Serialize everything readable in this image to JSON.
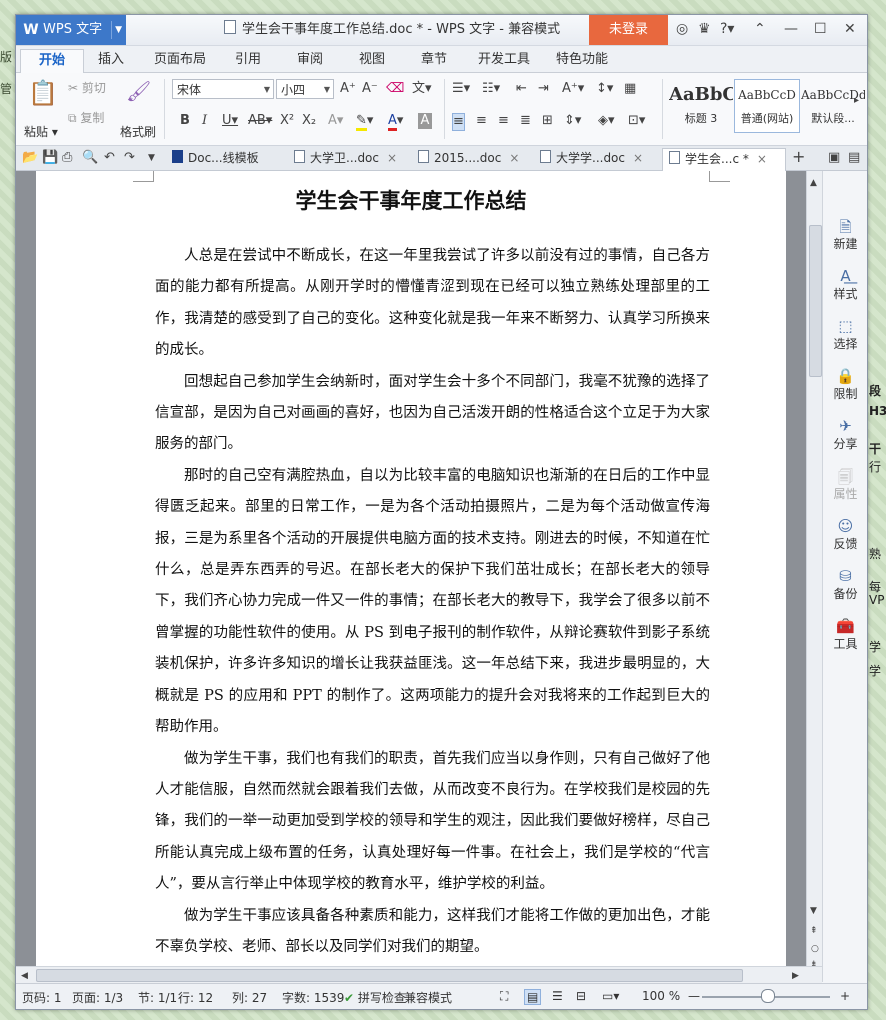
{
  "window": {
    "app_button": "WPS 文字",
    "title": "学生会干事年度工作总结.doc * - WPS 文字 - 兼容模式",
    "login": "未登录"
  },
  "background": {
    "left_fragments": [
      "版",
      "管"
    ],
    "right_fragments": [
      "段",
      "H3",
      "干",
      "行",
      "熟",
      "每",
      "VP",
      "学",
      "学"
    ]
  },
  "ribbon_tabs": [
    "开始",
    "插入",
    "页面布局",
    "引用",
    "审阅",
    "视图",
    "章节",
    "开发工具",
    "特色功能"
  ],
  "ribbon": {
    "paste": "粘贴",
    "cut": "剪切",
    "copy": "复制",
    "format_painter": "格式刷",
    "font_name": "宋体",
    "font_size": "小四",
    "styles": [
      {
        "sample": "AaBbC",
        "label": "标题 3"
      },
      {
        "sample": "AaBbCcD",
        "label": "普通(网站)"
      },
      {
        "sample": "AaBbCcDd",
        "label": "默认段..."
      }
    ]
  },
  "doc_tabs": [
    {
      "label": "Doc...线模板",
      "active": false
    },
    {
      "label": "大学卫...doc",
      "active": false
    },
    {
      "label": "2015....doc",
      "active": false
    },
    {
      "label": "大学学...doc",
      "active": false
    },
    {
      "label": "学生会...c *",
      "active": true
    }
  ],
  "document": {
    "title": "学生会干事年度工作总结",
    "paragraphs": [
      "人总是在尝试中不断成长，在这一年里我尝试了许多以前没有过的事情，自己各方面的能力都有所提高。从刚开学时的懵懂青涩到现在已经可以独立熟练处理部里的工作，我清楚的感受到了自己的变化。这种变化就是我一年来不断努力、认真学习所换来的成长。",
      "回想起自己参加学生会纳新时，面对学生会十多个不同部门，我毫不犹豫的选择了信宣部，是因为自己对画画的喜好，也因为自己活泼开朗的性格适合这个立足于为大家服务的部门。",
      "那时的自己空有满腔热血，自以为比较丰富的电脑知识也渐渐的在日后的工作中显得匮乏起来。部里的日常工作，一是为各个活动拍摄照片，二是为每个活动做宣传海报，三是为系里各个活动的开展提供电脑方面的技术支持。刚进去的时候，不知道在忙什么，总是弄东西弄的号迟。在部长老大的保护下我们茁壮成长；在部长老大的领导下，我们齐心协力完成一件又一件的事情；在部长老大的教导下，我学会了很多以前不曾掌握的功能性软件的使用。从 PS 到电子报刊的制作软件，从辩论赛软件到影子系统装机保护，许多许多知识的增长让我获益匪浅。这一年总结下来，我进步最明显的，大概就是 PS 的应用和 PPT 的制作了。这两项能力的提升会对我将来的工作起到巨大的帮助作用。",
      "做为学生干事，我们也有我们的职责，首先我们应当以身作则，只有自己做好了他人才能信服，自然而然就会跟着我们去做，从而改变不良行为。在学校我们是校园的先锋，我们的一举一动更加受到学校的领导和学生的观注，因此我们要做好榜样，尽自己所能认真完成上级布置的任务，认真处理好每一件事。在社会上，我们是学校的“代言人”，要从言行举止中体现学校的教育水平，维护学校的利益。",
      "做为学生干事应该具备各种素质和能力，这样我们才能将工作做的更加出色，才能不辜负学校、老师、部长以及同学们对我们的期望。"
    ]
  },
  "task_panel": [
    {
      "label": "新建",
      "enabled": true
    },
    {
      "label": "样式",
      "enabled": true
    },
    {
      "label": "选择",
      "enabled": true
    },
    {
      "label": "限制",
      "enabled": true
    },
    {
      "label": "分享",
      "enabled": true
    },
    {
      "label": "属性",
      "enabled": false
    },
    {
      "label": "反馈",
      "enabled": true
    },
    {
      "label": "备份",
      "enabled": true
    },
    {
      "label": "工具",
      "enabled": true
    }
  ],
  "status": {
    "page": "页码: 1",
    "pages": "页面: 1/3",
    "section": "节: 1/1",
    "line": "行: 12",
    "col": "列: 27",
    "words": "字数: 1539",
    "spell": "拼写检查",
    "mode": "兼容模式",
    "zoom": "100 %",
    "zoom_value": 100
  }
}
